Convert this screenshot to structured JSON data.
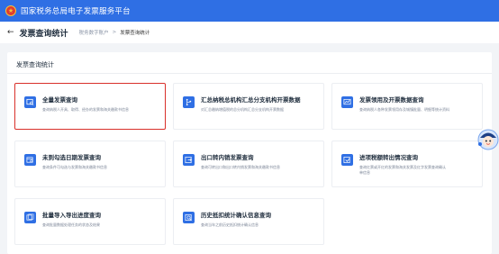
{
  "app": {
    "title": "国家税务总局电子发票服务平台",
    "logo_icon": "tax-emblem-icon"
  },
  "header": {
    "back_icon": "arrow-left-icon",
    "title": "发票查询统计",
    "breadcrumb": [
      "税务数字账户",
      "发票查询统计"
    ]
  },
  "section": {
    "title": "发票查询统计"
  },
  "cards": [
    {
      "title": "全量发票查询",
      "desc": "查询纳税人开具、取得、经办的发票和海关缴款书信息",
      "desc2": "",
      "icon": "invoice-search-icon"
    },
    {
      "title": "汇总纳税总机构汇总分支机构开票数据",
      "desc": "对汇总缴纳增值税的总分机构汇总分支机构开票数据",
      "desc2": "",
      "icon": "branch-icon"
    },
    {
      "title": "发票领用及开票数据查询",
      "desc": "查询纳税人各种发票领用存及城镇批量、明细等统计资料",
      "desc2": "",
      "icon": "chart-icon"
    },
    {
      "title": "未到勾选日期发票查询",
      "desc": "查询条件可勾选与发票和海关缴款书信息",
      "desc2": "",
      "icon": "calendar-search-icon"
    },
    {
      "title": "出口转内销发票查询",
      "desc": "查询可转出口和出口转内销发票和海关缴款书信息",
      "desc2": "",
      "icon": "export-icon"
    },
    {
      "title": "进项税额转出情况查询",
      "desc": "查询红票或开红的发票和海关发票及红字发票查询确认",
      "desc2": "单信息",
      "icon": "tax-transfer-icon"
    },
    {
      "title": "批量导入导出进度查询",
      "desc": "查询批量数据处理任务的状态及结果",
      "desc2": "",
      "icon": "batch-icon"
    },
    {
      "title": "历史抵扣统计确认信息查询",
      "desc": "查询当年之前历史抵扣统计确认信息",
      "desc2": "",
      "icon": "history-search-icon"
    }
  ],
  "colors": {
    "primary": "#2f6fe4",
    "highlight_border": "#d9302a"
  }
}
